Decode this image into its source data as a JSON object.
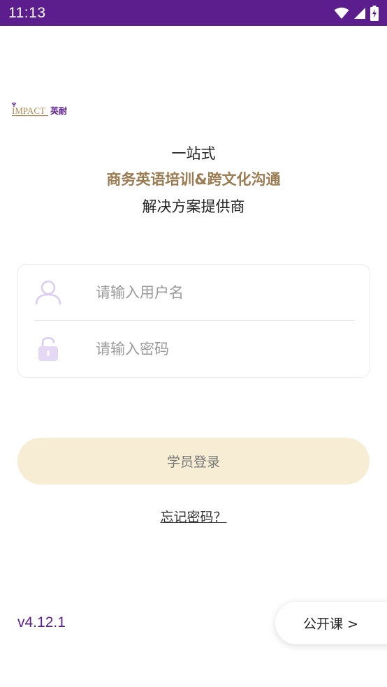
{
  "status_bar": {
    "time": "11:13",
    "icons": [
      "wifi-icon",
      "cellular-signal-icon",
      "battery-charging-icon"
    ],
    "background": "#5b1e8c"
  },
  "logo": {
    "brand": "IMPACT",
    "brand_cn": "英耐",
    "accent": "#5b1e8c",
    "gold": "#b08a4e"
  },
  "tagline": {
    "line1": "一站式",
    "line2": "商务英语培训&跨文化沟通",
    "line3": "解决方案提供商",
    "highlight_color": "#9b7b52"
  },
  "login_form": {
    "username_placeholder": "请输入用户名",
    "password_placeholder": "请输入密码",
    "username_icon": "user-icon",
    "password_icon": "lock-icon",
    "icon_color": "#dccdf0"
  },
  "login_button": {
    "label": "学员登录",
    "background": "#f7ecd4"
  },
  "forgot_password": {
    "label": "忘记密码？"
  },
  "footer": {
    "version": "v4.12.1",
    "open_course_label": "公开课 >"
  }
}
